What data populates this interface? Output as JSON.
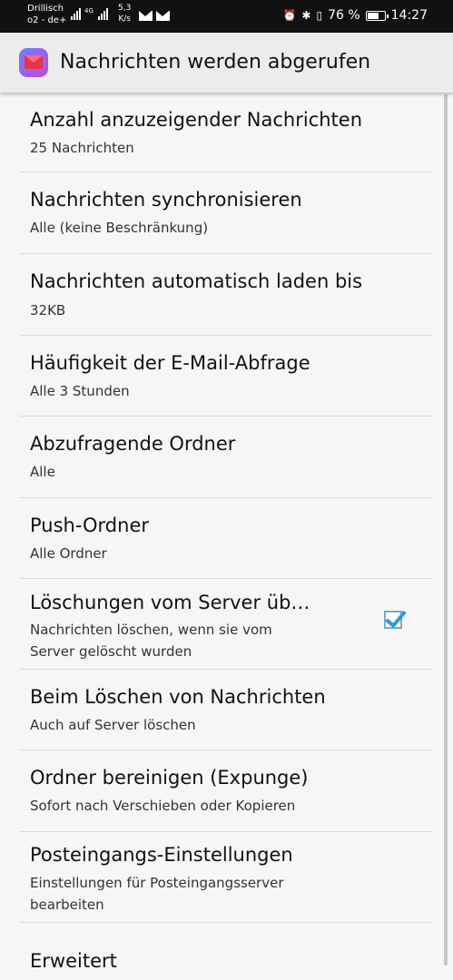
{
  "status_bar": {
    "carrier_line1": "Drillisch",
    "carrier_line2": "o2 - de+",
    "network": "4G",
    "speed_value": "5,3",
    "speed_unit": "K/s",
    "battery_percent": "76 %",
    "battery_level": 0.76,
    "time": "14:27"
  },
  "app_bar": {
    "title": "Nachrichten werden abgerufen"
  },
  "settings": [
    {
      "title": "Anzahl anzuzeigender Nachrichten",
      "sub": "25 Nachrichten"
    },
    {
      "title": "Nachrichten synchronisieren",
      "sub": "Alle (keine Beschränkung)"
    },
    {
      "title": "Nachrichten automatisch laden bis",
      "sub": "32KB"
    },
    {
      "title": "Häufigkeit der E-Mail-Abfrage",
      "sub": "Alle 3 Stunden"
    },
    {
      "title": "Abzufragende Ordner",
      "sub": "Alle"
    },
    {
      "title": "Push-Ordner",
      "sub": "Alle Ordner"
    },
    {
      "title": "Löschungen vom Server üb…",
      "sub_line1": "Nachrichten löschen, wenn sie vom",
      "sub_line2": "Server gelöscht wurden",
      "checked": true
    },
    {
      "title": "Beim Löschen von Nachrichten",
      "sub": "Auch auf Server löschen"
    },
    {
      "title": "Ordner bereinigen (Expunge)",
      "sub": "Sofort nach Verschieben oder Kopieren"
    },
    {
      "title": "Posteingangs-Einstellungen",
      "sub_line1": "Einstellungen für Posteingangsserver",
      "sub_line2": "bearbeiten"
    },
    {
      "title": "Erweitert"
    }
  ]
}
